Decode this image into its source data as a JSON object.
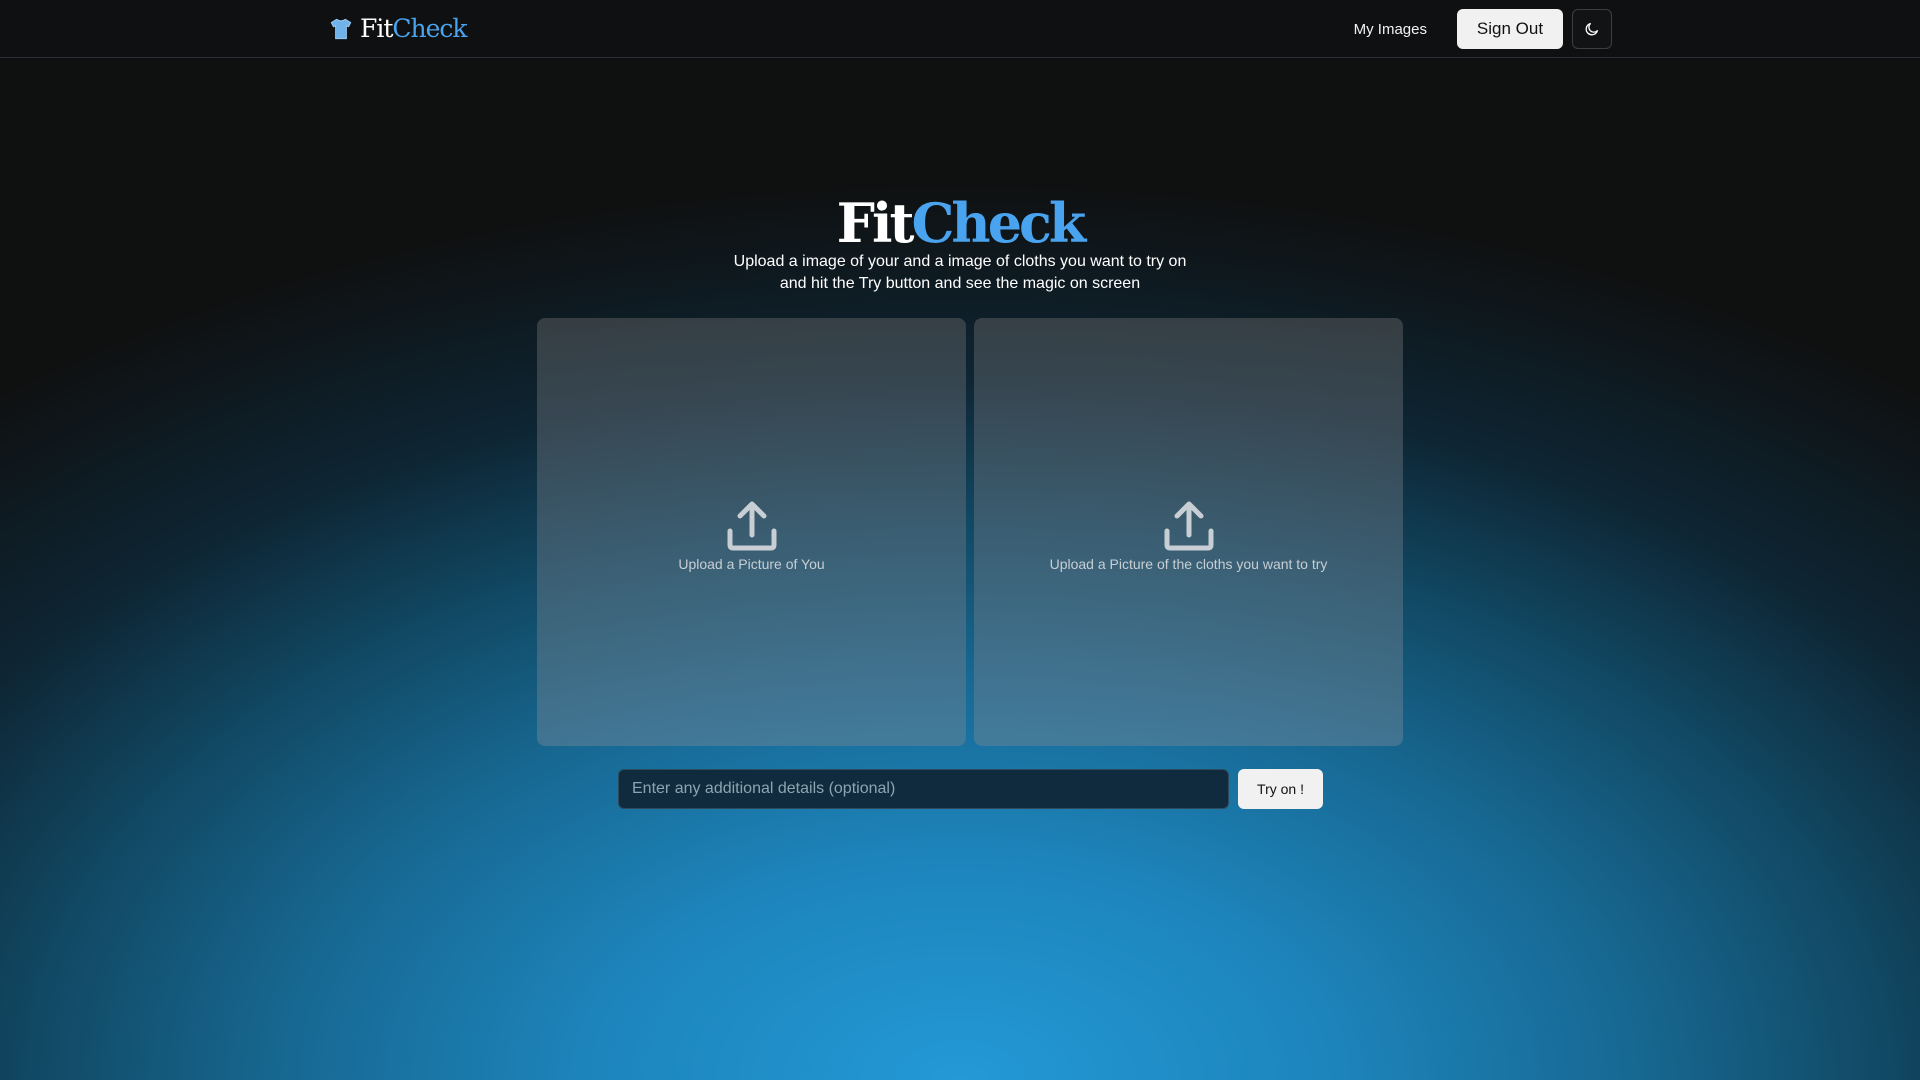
{
  "header": {
    "brand": {
      "part1": "Fit",
      "part2": "Check",
      "icon": "tshirt-icon"
    },
    "nav": {
      "my_images": "My Images",
      "sign_out": "Sign Out",
      "theme_icon": "moon-icon"
    }
  },
  "hero": {
    "title_part1": "Fit",
    "title_part2": "Check",
    "subtitle_line1": "Upload a image of your and a image of cloths you want to try on",
    "subtitle_line2": "and hit the Try button and see the magic on screen"
  },
  "uploads": [
    {
      "label": "Upload a Picture of You",
      "icon": "upload-icon"
    },
    {
      "label": "Upload a Picture of the cloths you want to try",
      "icon": "upload-icon"
    }
  ],
  "details": {
    "value": "",
    "placeholder": "Enter any additional details (optional)"
  },
  "try_button": {
    "label": "Try on !"
  },
  "colors": {
    "accent": "#4aa3ef",
    "background_top": "#0f1010",
    "background_bottom": "#2399d6"
  }
}
